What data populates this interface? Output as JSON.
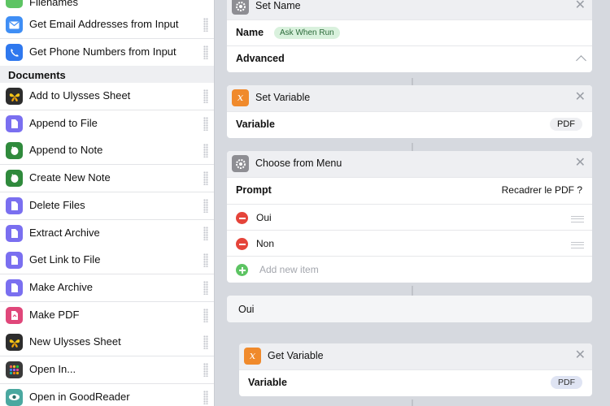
{
  "sidebar": {
    "top_partial": "Filenames",
    "items_top": [
      {
        "label": "Get Email Addresses from Input",
        "icon": "envelope-icon",
        "color": "#3f8ef5"
      },
      {
        "label": "Get Phone Numbers from Input",
        "icon": "phone-icon",
        "color": "#2f78ee"
      }
    ],
    "section": "Documents",
    "items": [
      {
        "label": "Add to Ulysses Sheet",
        "icon": "ulysses-butterfly-icon",
        "color": "#2d2d2d"
      },
      {
        "label": "Append to File",
        "icon": "file-icon",
        "color": "#7a6ff0"
      },
      {
        "label": "Append to Note",
        "icon": "evernote-icon",
        "color": "#2f8a3c"
      },
      {
        "label": "Create New Note",
        "icon": "evernote-icon",
        "color": "#2f8a3c"
      },
      {
        "label": "Delete Files",
        "icon": "file-icon",
        "color": "#7a6ff0"
      },
      {
        "label": "Extract Archive",
        "icon": "file-icon",
        "color": "#7a6ff0"
      },
      {
        "label": "Get Link to File",
        "icon": "file-icon",
        "color": "#7a6ff0"
      },
      {
        "label": "Make Archive",
        "icon": "file-icon",
        "color": "#7a6ff0"
      },
      {
        "label": "Make PDF",
        "icon": "pdf-icon",
        "color": "#e0477a"
      },
      {
        "label": "New Ulysses Sheet",
        "icon": "ulysses-butterfly-icon",
        "color": "#2d2d2d"
      },
      {
        "label": "Open In...",
        "icon": "grid-icon",
        "color": "#3a3a3a"
      },
      {
        "label": "Open in GoodReader",
        "icon": "eye-icon",
        "color": "#4aa8a0"
      }
    ]
  },
  "workflow": {
    "set_name": {
      "title": "Set Name",
      "name_label": "Name",
      "name_value": "Ask When Run",
      "advanced_label": "Advanced"
    },
    "set_variable": {
      "title": "Set Variable",
      "variable_label": "Variable",
      "variable_value": "PDF"
    },
    "choose_menu": {
      "title": "Choose from Menu",
      "prompt_label": "Prompt",
      "prompt_value": "Recadrer le PDF ?",
      "items": [
        "Oui",
        "Non"
      ],
      "add_placeholder": "Add new item"
    },
    "oui_label": "Oui",
    "get_variable": {
      "title": "Get Variable",
      "variable_label": "Variable",
      "variable_value": "PDF"
    }
  },
  "colors": {
    "settings": "#8e8e93",
    "variable": "#f08a2c",
    "accent_remove": "#e5443a",
    "accent_add": "#5dc463"
  }
}
